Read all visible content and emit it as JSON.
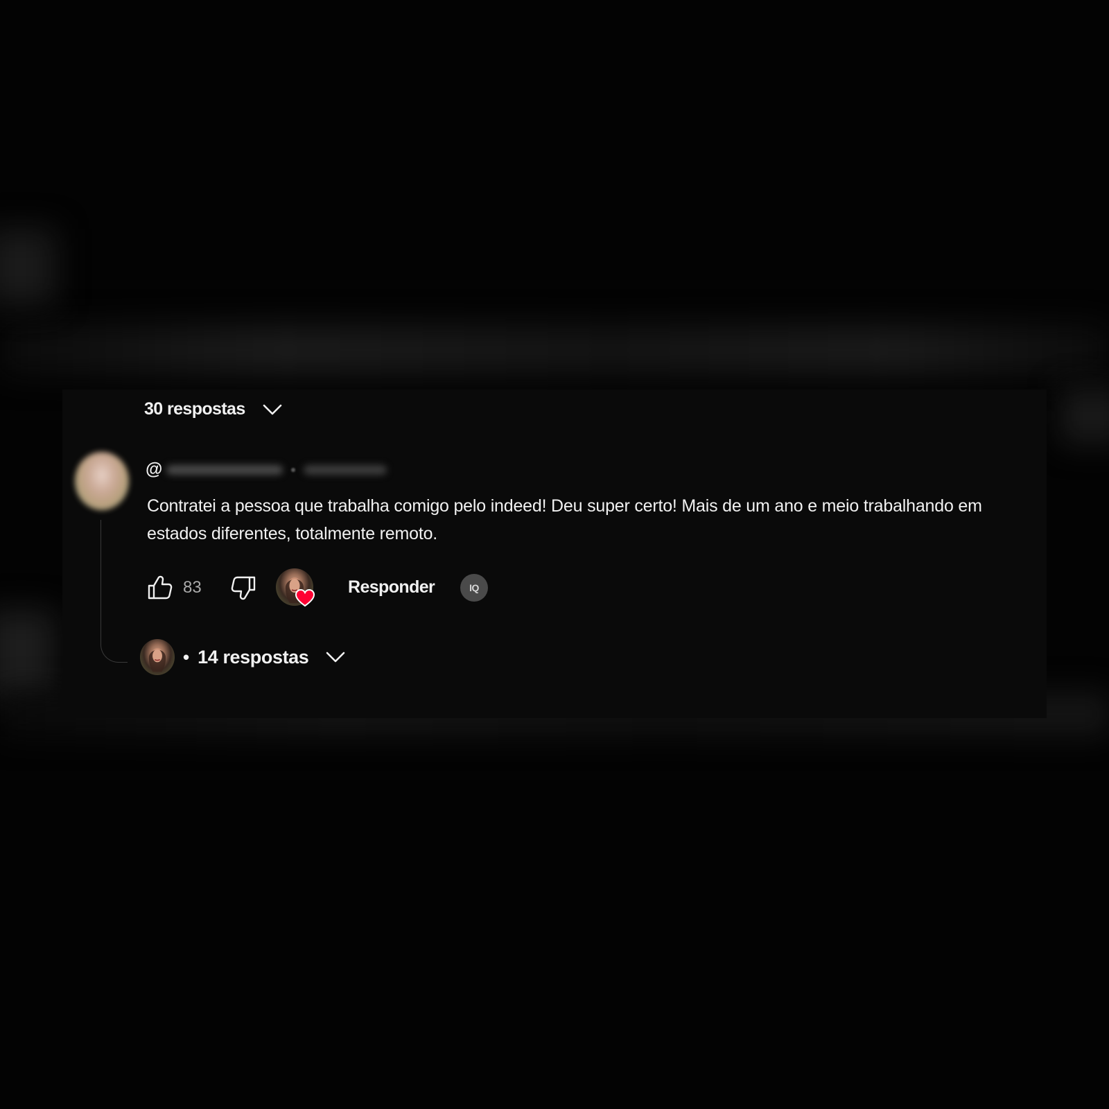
{
  "thread": {
    "replies_toggle_label": "30 respostas"
  },
  "comment": {
    "handle_prefix": "@",
    "text": "Contratei a pessoa que trabalha comigo pelo indeed! Deu super certo! Mais de um ano e meio trabalhando em estados diferentes, totalmente remoto.",
    "like_count": "83",
    "reply_label": "Responder",
    "extension_badge": "IQ",
    "creator_hearted": true,
    "replies_bullet": "•",
    "replies_label": "14 respostas"
  },
  "icons": {
    "like": "thumbs-up-icon",
    "dislike": "thumbs-down-icon",
    "expand": "chevron-down-icon",
    "heart": "heart-icon"
  },
  "colors": {
    "background": "#030303",
    "card": "#0a0a0a",
    "text": "#f1f1f1",
    "secondary_text": "#aaaaaa",
    "heart": "#ff0033"
  }
}
